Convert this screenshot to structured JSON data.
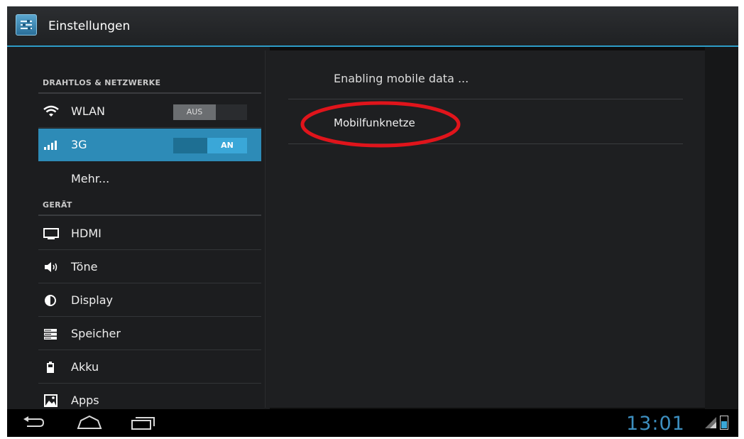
{
  "window": {
    "title": "Einstellungen",
    "app_icon": "settings-sliders-icon"
  },
  "sidebar": {
    "sections": [
      {
        "header": "DRAHTLOS & NETZWERKE"
      },
      {
        "header": "GERÄT"
      }
    ],
    "items": [
      {
        "label": "WLAN",
        "icon": "wifi-icon",
        "toggle": "AUS",
        "toggle_state": "off"
      },
      {
        "label": "3G",
        "icon": "signal-bars-icon",
        "toggle": "AN",
        "toggle_state": "on",
        "selected": true
      },
      {
        "label": "Mehr..."
      },
      {
        "label": "HDMI",
        "icon": "monitor-icon"
      },
      {
        "label": "Töne",
        "icon": "speaker-icon"
      },
      {
        "label": "Display",
        "icon": "brightness-icon"
      },
      {
        "label": "Speicher",
        "icon": "storage-icon"
      },
      {
        "label": "Akku",
        "icon": "battery-icon"
      },
      {
        "label": "Apps",
        "icon": "apps-image-icon"
      }
    ]
  },
  "detail": {
    "items": [
      {
        "label": "Enabling mobile data ..."
      },
      {
        "label": "Mobilfunknetze",
        "highlighted": true
      }
    ],
    "highlight_color": "#e0141b"
  },
  "status_bar": {
    "time": "13:01",
    "nav": [
      "back-icon",
      "home-icon",
      "recent-apps-icon"
    ],
    "accent": "#3d8fc0"
  },
  "colors": {
    "accent": "#2d8bb7",
    "background": "#1c1d1f"
  }
}
